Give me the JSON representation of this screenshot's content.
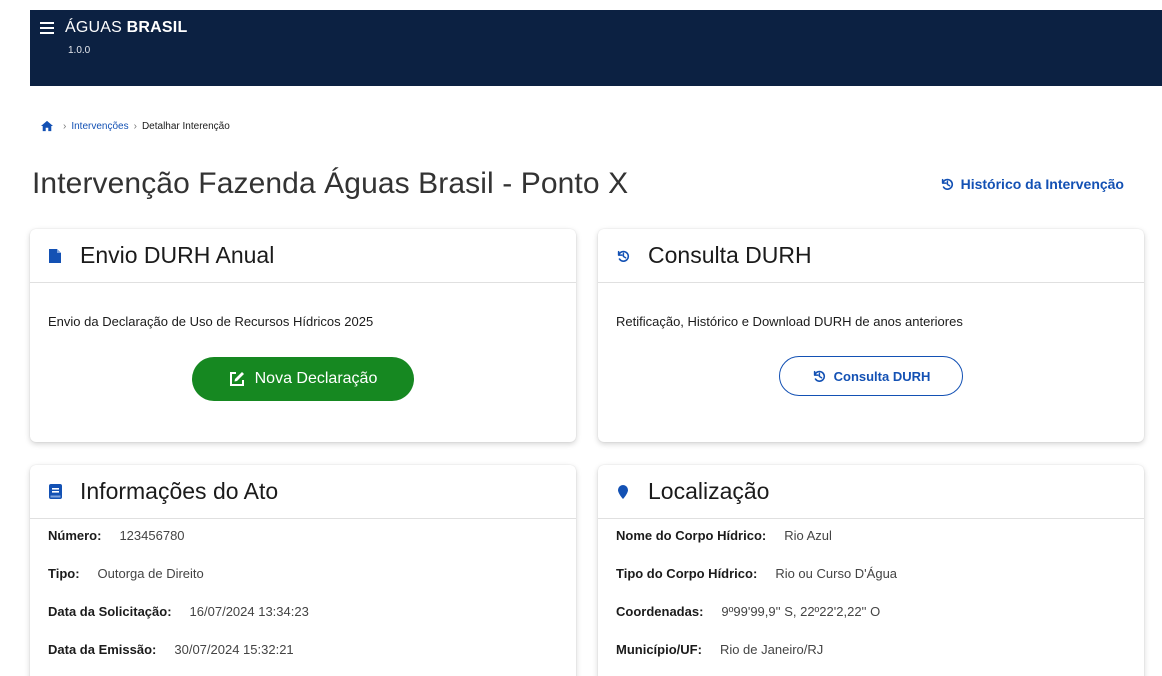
{
  "header": {
    "brand_light": "ÁGUAS",
    "brand_bold": "BRASIL",
    "version": "1.0.0"
  },
  "breadcrumb": {
    "items": [
      "Intervenções",
      "Detalhar Interenção"
    ]
  },
  "page": {
    "title": "Intervenção Fazenda Águas Brasil - Ponto X",
    "history_link": "Histórico da Intervenção"
  },
  "envio_card": {
    "title": "Envio DURH Anual",
    "description": "Envio da Declaração de Uso de Recursos Hídricos 2025",
    "button_label": "Nova Declaração"
  },
  "consulta_card": {
    "title": "Consulta DURH",
    "description": "Retificação, Histórico e Download DURH de anos anteriores",
    "button_label": "Consulta DURH"
  },
  "ato_card": {
    "title": "Informações do Ato",
    "rows": [
      {
        "label": "Número:",
        "value": "123456780"
      },
      {
        "label": "Tipo:",
        "value": "Outorga de Direito"
      },
      {
        "label": "Data da Solicitação:",
        "value": "16/07/2024 13:34:23"
      },
      {
        "label": "Data da Emissão:",
        "value": "30/07/2024 15:32:21"
      }
    ]
  },
  "localizacao_card": {
    "title": "Localização",
    "rows": [
      {
        "label": "Nome do Corpo Hídrico:",
        "value": "Rio Azul"
      },
      {
        "label": "Tipo do Corpo Hídrico:",
        "value": "Rio ou Curso D'Água"
      },
      {
        "label": "Coordenadas:",
        "value": "9º99'99,9'' S, 22º22'2,22'' O"
      },
      {
        "label": "Município/UF:",
        "value": "Rio de Janeiro/RJ"
      }
    ]
  },
  "icons": {
    "menu": "menu-icon",
    "home": "home-icon",
    "history": "history-icon",
    "file": "file-icon",
    "edit": "edit-icon",
    "book": "book-icon",
    "map_pin": "map-pin-icon"
  },
  "colors": {
    "header_bg": "#0c2142",
    "primary_blue": "#1351b4",
    "success_green": "#168821"
  }
}
